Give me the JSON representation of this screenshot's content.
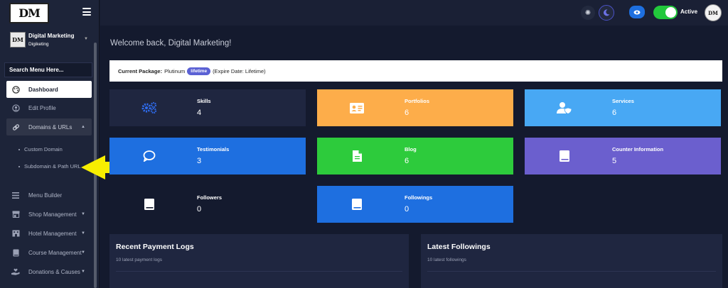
{
  "logo": {
    "text": "DM"
  },
  "user": {
    "name": "Digital Marketing",
    "subtitle": "Digiketing",
    "avatar_text": "DM"
  },
  "search": {
    "placeholder": "Search Menu Here..."
  },
  "menu": {
    "dashboard": "Dashboard",
    "edit_profile": "Edit Profile",
    "domains": "Domains & URLs",
    "custom_domain": "Custom Domain",
    "subdomain": "Subdomain & Path URL",
    "menu_builder": "Menu Builder",
    "shop": "Shop Management",
    "hotel": "Hotel Management",
    "course": "Course Management",
    "donations": "Donations & Causes"
  },
  "topbar": {
    "status_label": "Active",
    "avatar_text": "DM"
  },
  "welcome": "Welcome back, Digital Marketing!",
  "package": {
    "label": "Current Package:",
    "name": "Plutinum",
    "badge": "lifetime",
    "expire": "(Expire Date: Lifetime)"
  },
  "cards": [
    {
      "title": "Skills",
      "value": "4",
      "icon": "gears-icon",
      "color": "#1f2640"
    },
    {
      "title": "Portfolios",
      "value": "6",
      "icon": "id-card-icon",
      "color": "#fdad4a"
    },
    {
      "title": "Services",
      "value": "6",
      "icon": "user-shield-icon",
      "color": "#48a8f4"
    },
    {
      "title": "Testimonials",
      "value": "3",
      "icon": "comment-icon",
      "color": "#1e6fe0"
    },
    {
      "title": "Blog",
      "value": "6",
      "icon": "file-icon",
      "color": "#2dcb3c"
    },
    {
      "title": "Counter Information",
      "value": "5",
      "icon": "book-icon",
      "color": "#6b5fce"
    },
    {
      "title": "Followers",
      "value": "0",
      "icon": "book-icon",
      "color": "#141a2e"
    },
    {
      "title": "Followings",
      "value": "0",
      "icon": "book-icon",
      "color": "#1e6fe0"
    }
  ],
  "panels": {
    "payments": {
      "title": "Recent Payment Logs",
      "subtitle": "10 latest payment logs"
    },
    "followings": {
      "title": "Latest Followings",
      "subtitle": "10 latest followings"
    }
  },
  "colors": {
    "accent": "#5b61d4",
    "toggle": "#22c83c",
    "arrow": "#f7ee00"
  }
}
